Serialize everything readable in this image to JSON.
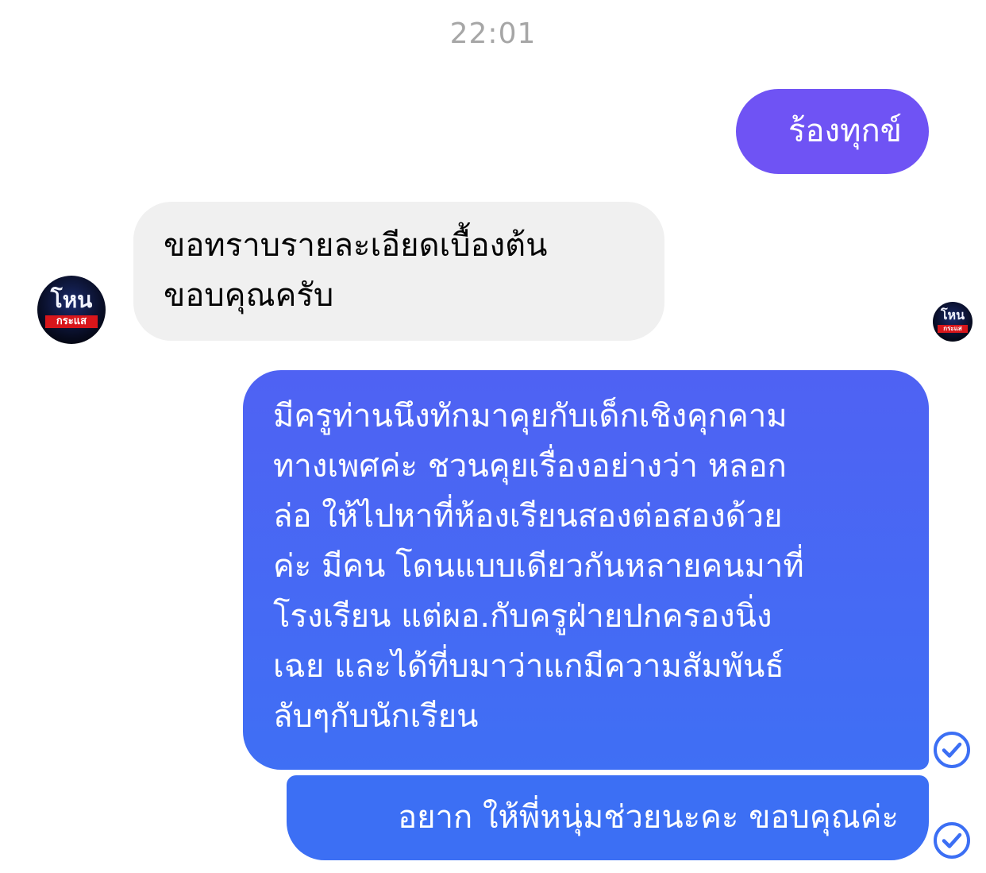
{
  "chat": {
    "timestamp": "22:01",
    "avatar_logo": {
      "top": "โหน",
      "bottom": "กระแส"
    },
    "colors": {
      "outgoing_first": "#6f53f4",
      "outgoing_blue": "#3c6ff4",
      "incoming": "#f0f0f0",
      "timestamp": "#a6a6a6",
      "delivered_check": "#3c6ff4"
    },
    "messages": [
      {
        "direction": "outgoing",
        "text": "ร้องทุกข์"
      },
      {
        "direction": "incoming",
        "text": "ขอทราบรายละเอียดเบื้องต้น\nขอบคุณครับ"
      },
      {
        "direction": "outgoing",
        "text": "มีครูท่านนึงทักมาคุยกับเด็กเชิงคุกคาม\nทางเพศค่ะ ชวนคุยเรื่องอย่างว่า หลอก\nล่อ ให้ไปหาที่ห้องเรียนสองต่อสองด้วย\nค่ะ มีคน โดนแบบเดียวกันหลายคนมาที่\nโรงเรียน แต่ผอ.กับครูฝ่ายปกครองนิ่ง\nเฉย และได้ที่บมาว่าแกมีความสัมพันธ์\nลับๆกับนักเรียน"
      },
      {
        "direction": "outgoing",
        "text": "อยาก ให้พี่หนุ่มช่วยนะคะ ขอบคุณค่ะ"
      }
    ],
    "icons": {
      "seen_avatar": "seen-avatar-icon",
      "delivered": "check-circle-icon"
    }
  }
}
